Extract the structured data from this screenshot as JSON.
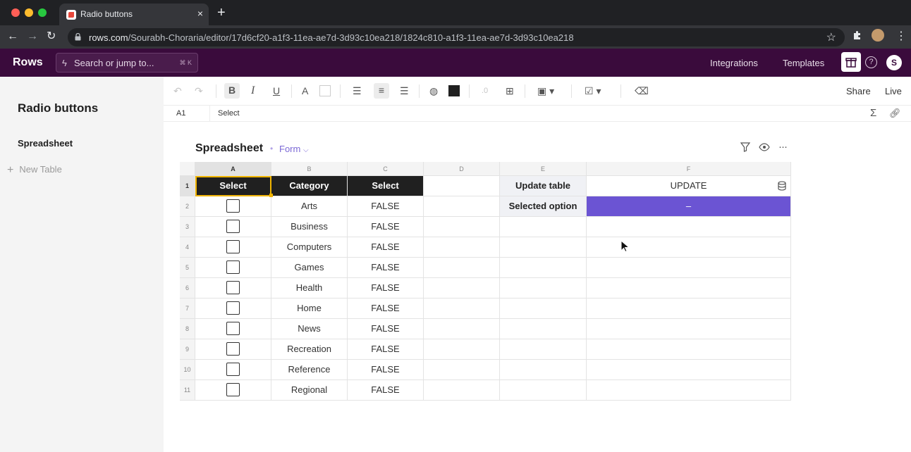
{
  "browser": {
    "tab_title": "Radio buttons",
    "tab_close": "×",
    "new_tab": "+",
    "url_host": "rows.com",
    "url_path": "/Sourabh-Choraria/editor/17d6cf20-a1f3-11ea-ae7d-3d93c10ea218/1824c810-a1f3-11ea-ae7d-3d93c10ea218",
    "traffic_colors": [
      "#ff5f57",
      "#febc2e",
      "#28c840"
    ]
  },
  "header": {
    "logo": "Rows",
    "search_placeholder": "Search or jump to...",
    "search_shortcut": "⌘ K",
    "integrations": "Integrations",
    "templates": "Templates",
    "help": "?",
    "avatar_initial": "S",
    "accent": "#3a0b3c"
  },
  "sidebar": {
    "doc_title": "Radio buttons",
    "items": [
      {
        "label": "Spreadsheet"
      }
    ],
    "new_table": "New Table"
  },
  "toolbar": {
    "share": "Share",
    "live": "Live",
    "icons": [
      "undo-icon",
      "redo-icon",
      "bold-icon",
      "italic-icon",
      "underline-icon",
      "text-color-icon",
      "fill-color-icon",
      "align-left-icon",
      "align-center-icon",
      "align-right-icon",
      "palette-icon",
      "cell-color-icon",
      "decimal-icon",
      "merge-icon",
      "cell-type-icon",
      "checkbox-type-icon",
      "clear-format-icon"
    ]
  },
  "formula": {
    "cell_ref": "A1",
    "value": "Select"
  },
  "table": {
    "title": "Spreadsheet",
    "view": "Form",
    "columns": [
      "A",
      "B",
      "C",
      "D",
      "E",
      "F"
    ],
    "rows": [
      {
        "num": "1",
        "a": "Select",
        "b": "Category",
        "c": "Select",
        "e": "Update table",
        "f": "UPDATE"
      },
      {
        "num": "2",
        "b": "Arts",
        "c": "FALSE",
        "e": "Selected option",
        "f": "–"
      },
      {
        "num": "3",
        "b": "Business",
        "c": "FALSE"
      },
      {
        "num": "4",
        "b": "Computers",
        "c": "FALSE"
      },
      {
        "num": "5",
        "b": "Games",
        "c": "FALSE"
      },
      {
        "num": "6",
        "b": "Health",
        "c": "FALSE"
      },
      {
        "num": "7",
        "b": "Home",
        "c": "FALSE"
      },
      {
        "num": "8",
        "b": "News",
        "c": "FALSE"
      },
      {
        "num": "9",
        "b": "Recreation",
        "c": "FALSE"
      },
      {
        "num": "10",
        "b": "Reference",
        "c": "FALSE"
      },
      {
        "num": "11",
        "b": "Regional",
        "c": "FALSE"
      }
    ],
    "colors": {
      "header_cells": "#202020",
      "selected_option": "#6b54d3",
      "selection": "#f0b400"
    }
  }
}
